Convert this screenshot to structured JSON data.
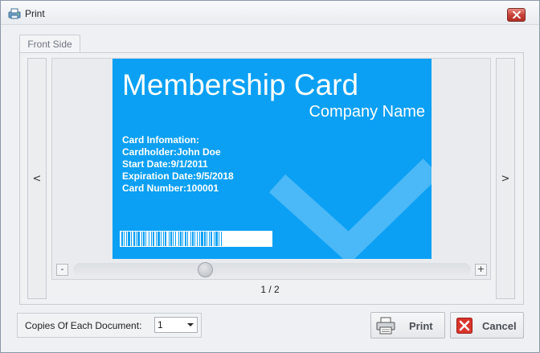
{
  "window": {
    "title": "Print"
  },
  "tabs": [
    {
      "label": "Front Side"
    }
  ],
  "navigation": {
    "prev_label": "<",
    "next_label": ">"
  },
  "card": {
    "title": "Membership Card",
    "company": "Company Name",
    "info": [
      "Card Infomation:",
      "Cardholder:John Doe",
      "Start Date:9/1/2011",
      "Expiration Date:9/5/2018",
      "Card Number:100001"
    ],
    "background_color": "#0ba0f4"
  },
  "zoom": {
    "minus_label": "-",
    "plus_label": "+",
    "level_fraction": 0.33
  },
  "page_indicator": "1 / 2",
  "copies": {
    "label": "Copies Of Each Document:",
    "value": "1"
  },
  "buttons": {
    "print_label": "Print",
    "cancel_label": "Cancel"
  },
  "icons": {
    "app": "printer-window-icon",
    "close": "close-icon",
    "print": "printer-icon",
    "cancel": "cancel-x-icon"
  },
  "colors": {
    "close_button": "#c9423a",
    "cancel_icon": "#d9342b"
  }
}
